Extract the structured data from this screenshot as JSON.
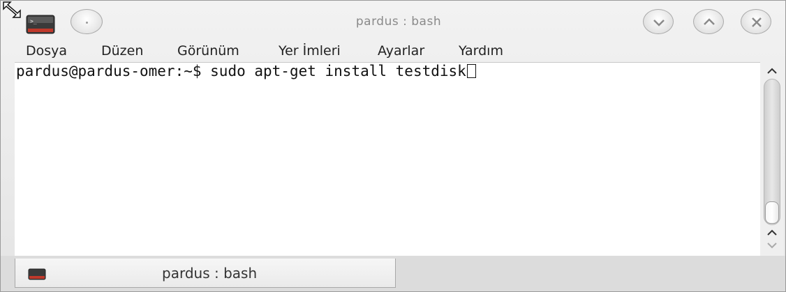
{
  "window": {
    "title": "pardus : bash"
  },
  "menubar": {
    "items": [
      "Dosya",
      "Düzen",
      "Görünüm",
      "Yer İmleri",
      "Ayarlar",
      "Yardım"
    ]
  },
  "terminal": {
    "prompt": "pardus@pardus-omer:~$ ",
    "command": "sudo apt-get install testdisk"
  },
  "tabs": [
    {
      "label": "pardus : bash",
      "icon": "terminal-icon"
    }
  ],
  "icons": {
    "app": "terminal-icon",
    "minimize": "chevron-down-icon",
    "maximize": "chevron-up-icon",
    "close": "close-icon",
    "resize": "resize-icon"
  }
}
